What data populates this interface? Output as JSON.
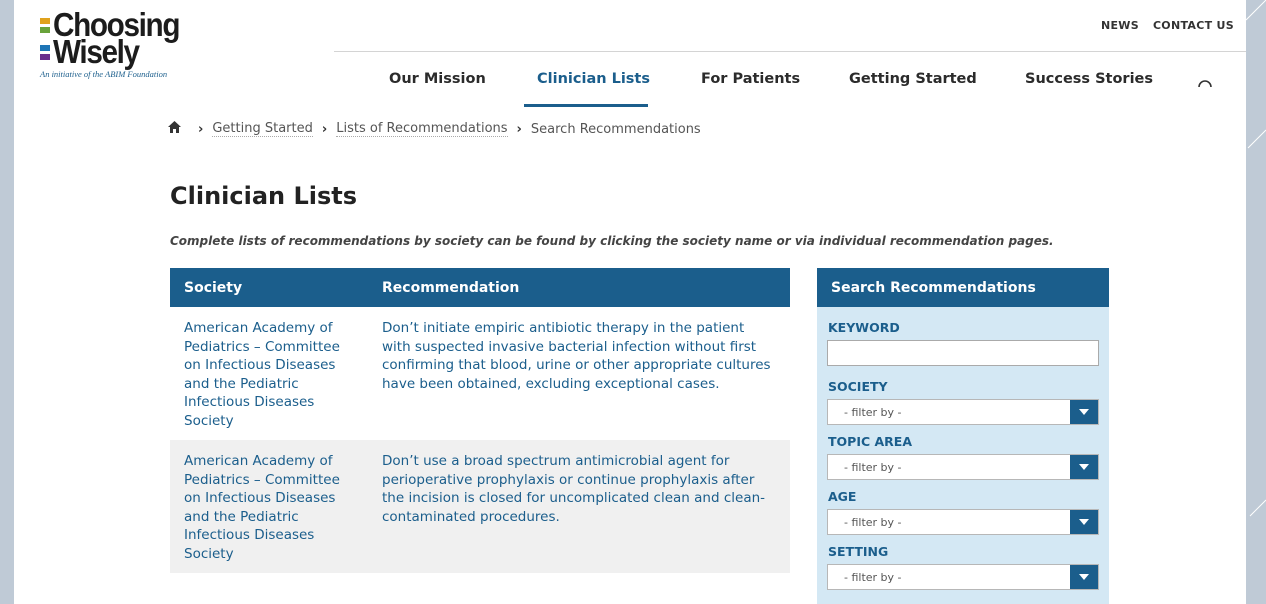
{
  "brand": {
    "name_line1": "Choosing",
    "name_line2": "Wisely",
    "tagline": "An initiative of the ABIM Foundation",
    "bar_colors": [
      "#e0a21d",
      "#69a33b",
      "#1e75b6",
      "#6a2e8d"
    ]
  },
  "utility_nav": {
    "news": "NEWS",
    "contact": "CONTACT US"
  },
  "main_nav": {
    "items": [
      "Our Mission",
      "Clinician Lists",
      "For Patients",
      "Getting Started",
      "Success Stories"
    ],
    "active": "Clinician Lists",
    "search_icon": "search-icon"
  },
  "breadcrumb": {
    "home_icon": "home-icon",
    "items": [
      "Getting Started",
      "Lists of Recommendations",
      "Search Recommendations"
    ]
  },
  "page": {
    "title": "Clinician Lists",
    "intro": "Complete lists of recommendations by society can be found by clicking the society name or via individual recommendation pages."
  },
  "table": {
    "headers": [
      "Society",
      "Recommendation"
    ],
    "rows": [
      {
        "society": "American Academy of Pediatrics – Committee on Infectious Diseases and the Pediatric Infectious Diseases Society",
        "recommendation": "Don’t initiate empiric antibiotic therapy in the patient with suspected invasive bacterial infection without first confirming that blood, urine or other appropriate cultures have been obtained, excluding exceptional cases."
      },
      {
        "society": "American Academy of Pediatrics – Committee on Infectious Diseases and the Pediatric Infectious Diseases Society",
        "recommendation": "Don’t use a broad spectrum antimicrobial agent for perioperative prophylaxis or continue prophylaxis after the incision is closed for uncomplicated clean and clean-contaminated procedures."
      }
    ]
  },
  "sidebar": {
    "title": "Search Recommendations",
    "keyword_label": "KEYWORD",
    "keyword_value": "",
    "filters": [
      {
        "label": "SOCIETY",
        "value": "- filter by -"
      },
      {
        "label": "TOPIC AREA",
        "value": "- filter by -"
      },
      {
        "label": "AGE",
        "value": "- filter by -"
      },
      {
        "label": "SETTING",
        "value": "- filter by -"
      }
    ]
  },
  "colors": {
    "primary": "#1b5e8c",
    "sidebar_bg": "#d4e8f4",
    "row_alt": "#f0f0f0",
    "frame": "#bfcad6"
  }
}
